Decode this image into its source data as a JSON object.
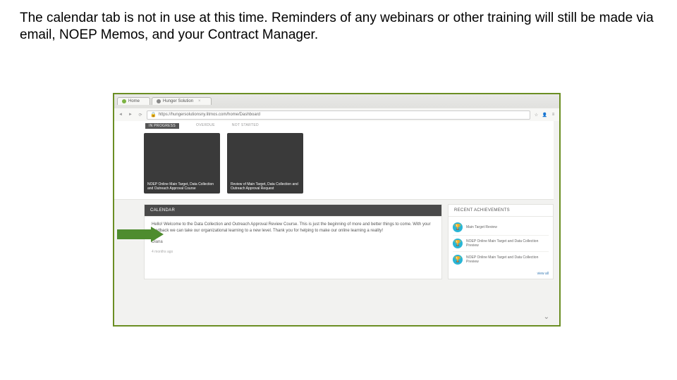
{
  "caption": "The calendar tab is not in use at this time. Reminders of any webinars or other training will still be made via email, NOEP Memos, and your Contract Manager.",
  "browser": {
    "tab1": "Home",
    "tab2": "Hunger Solution",
    "url": "https://hungersolutionsny.litmos.com/home/Dashboard",
    "controls": {
      "star": "☆",
      "user": "👤",
      "menu": "≡"
    }
  },
  "tiles_tabs": {
    "t1": "IN PROGRESS",
    "t2": "OVERDUE",
    "t3": "NOT STARTED"
  },
  "tiles": [
    {
      "caption": "NOEP Online Main Target, Data Collection and Outreach Approval Course"
    },
    {
      "caption": "Review of Main Target, Data Collection and Outreach Approval Request"
    }
  ],
  "calendar_header": "CALENDAR",
  "news": {
    "greeting": "Hello! Welcome to the Data Collection and Outreach Approval Review Course. This is just the beginning of more and better things to come. With your feedback we can take our organizational learning to a new level. Thank you for helping to make our online learning a reality!",
    "signature": "Diana",
    "meta": "4 months ago"
  },
  "achievements": {
    "header": "RECENT ACHIEVEMENTS",
    "items": [
      "Main Target Review",
      "NOEP Online Main Target and Data Collection Preview",
      "NOEP Online Main Target and Data Collection Preview"
    ],
    "view_all": "view all"
  }
}
